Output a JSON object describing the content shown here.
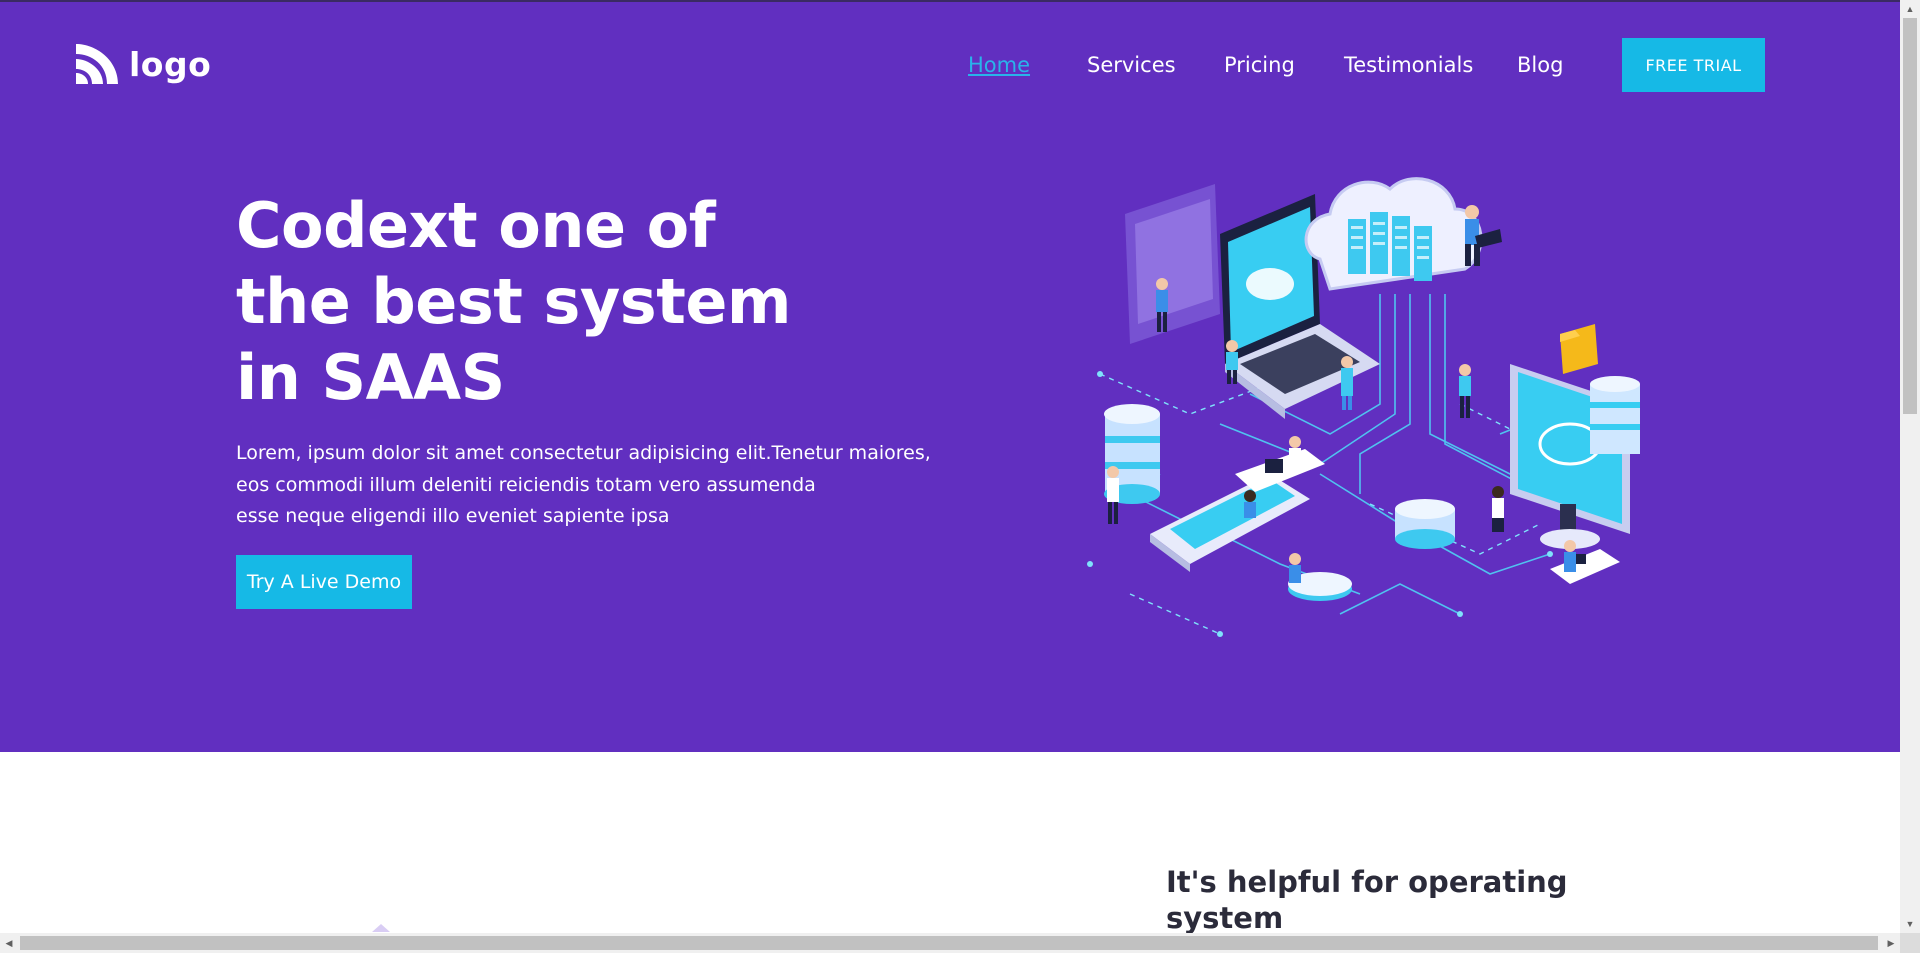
{
  "header": {
    "logo_text": "logo",
    "nav": [
      {
        "label": "Home",
        "active": true
      },
      {
        "label": "Services",
        "active": false
      },
      {
        "label": "Pricing",
        "active": false
      },
      {
        "label": "Testimonials",
        "active": false
      },
      {
        "label": "Blog",
        "active": false
      }
    ],
    "cta_label": "FREE TRIAL"
  },
  "hero": {
    "title_lines": [
      "Codext one of",
      "the best system",
      "in SAAS"
    ],
    "description_lines": [
      "Lorem, ipsum dolor sit amet consectetur adipisicing elit.Tenetur maiores,",
      "eos commodi illum deleniti reiciendis totam vero assumenda",
      "esse neque eligendi illo eveniet sapiente ipsa"
    ],
    "demo_button_label": "Try A Live Demo",
    "illustration_icon": "cloud-network-isometric-illustration"
  },
  "section2": {
    "title_lines": [
      "It's helpful for operating",
      "system"
    ]
  },
  "colors": {
    "hero_background": "#612fc0",
    "accent": "#16b9e6",
    "active_link": "#29b3ea",
    "text_dark": "#2b2b3a"
  },
  "scrollbars": {
    "arrow_up": "▲",
    "arrow_down": "▼",
    "arrow_left": "◀",
    "arrow_right": "▶"
  }
}
